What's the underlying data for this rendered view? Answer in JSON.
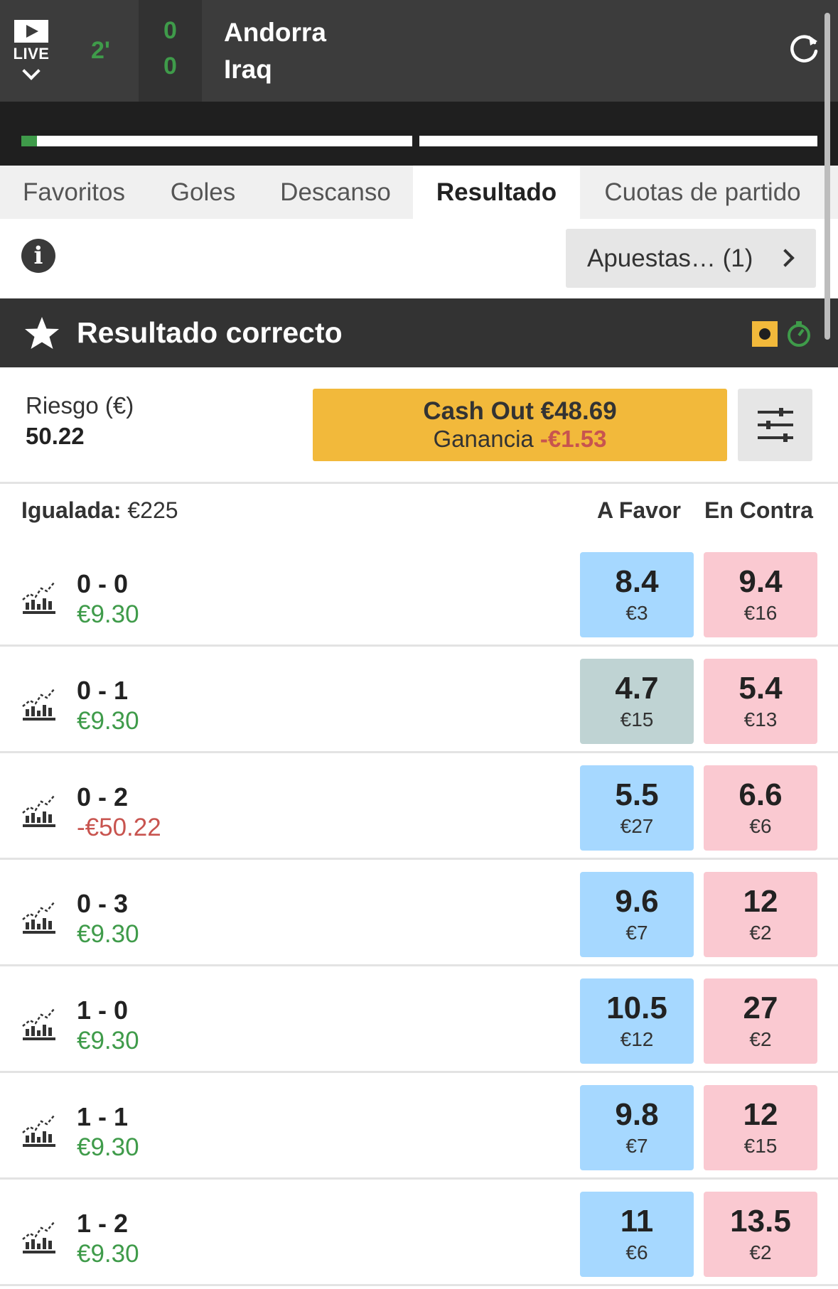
{
  "header": {
    "live_label": "LIVE",
    "minute": "2'",
    "home_score": "0",
    "away_score": "0",
    "home_team": "Andorra",
    "away_team": "Iraq",
    "progress_first_half": 0.04,
    "progress_second_half": 0.0
  },
  "tabs": [
    {
      "label": "Favoritos",
      "active": false
    },
    {
      "label": "Goles",
      "active": false
    },
    {
      "label": "Descanso",
      "active": false
    },
    {
      "label": "Resultado",
      "active": true
    },
    {
      "label": "Cuotas de partido",
      "active": false
    }
  ],
  "info": {
    "info_icon": "info-icon",
    "apuestas_label": "Apuestas… (1)"
  },
  "market": {
    "title": "Resultado correcto",
    "star_icon": "star-icon"
  },
  "cashout": {
    "riesgo_label": "Riesgo (€)",
    "riesgo_value": "50.22",
    "cashout_label": "Cash Out €48.69",
    "ganancia_label": "Ganancia",
    "ganancia_value": "-€1.53"
  },
  "columns": {
    "matched_label": "Igualada:",
    "matched_value": "€225",
    "back_label": "A Favor",
    "lay_label": "En Contra"
  },
  "colors": {
    "back": "#a6d8ff",
    "back_highlight": "#bfd3d3",
    "lay": "#fac9d1",
    "cashout": "#f2b93b",
    "positive": "#3f9b4a",
    "negative": "#c8544f"
  },
  "runners": [
    {
      "name": "0 - 0",
      "pl": "€9.30",
      "pl_negative": false,
      "back_price": "8.4",
      "back_size": "€3",
      "back_highlight": false,
      "lay_price": "9.4",
      "lay_size": "€16"
    },
    {
      "name": "0 - 1",
      "pl": "€9.30",
      "pl_negative": false,
      "back_price": "4.7",
      "back_size": "€15",
      "back_highlight": true,
      "lay_price": "5.4",
      "lay_size": "€13"
    },
    {
      "name": "0 - 2",
      "pl": "-€50.22",
      "pl_negative": true,
      "back_price": "5.5",
      "back_size": "€27",
      "back_highlight": false,
      "lay_price": "6.6",
      "lay_size": "€6"
    },
    {
      "name": "0 - 3",
      "pl": "€9.30",
      "pl_negative": false,
      "back_price": "9.6",
      "back_size": "€7",
      "back_highlight": false,
      "lay_price": "12",
      "lay_size": "€2"
    },
    {
      "name": "1 - 0",
      "pl": "€9.30",
      "pl_negative": false,
      "back_price": "10.5",
      "back_size": "€12",
      "back_highlight": false,
      "lay_price": "27",
      "lay_size": "€2"
    },
    {
      "name": "1 - 1",
      "pl": "€9.30",
      "pl_negative": false,
      "back_price": "9.8",
      "back_size": "€7",
      "back_highlight": false,
      "lay_price": "12",
      "lay_size": "€15"
    },
    {
      "name": "1 - 2",
      "pl": "€9.30",
      "pl_negative": false,
      "back_price": "11",
      "back_size": "€6",
      "back_highlight": false,
      "lay_price": "13.5",
      "lay_size": "€2"
    }
  ]
}
